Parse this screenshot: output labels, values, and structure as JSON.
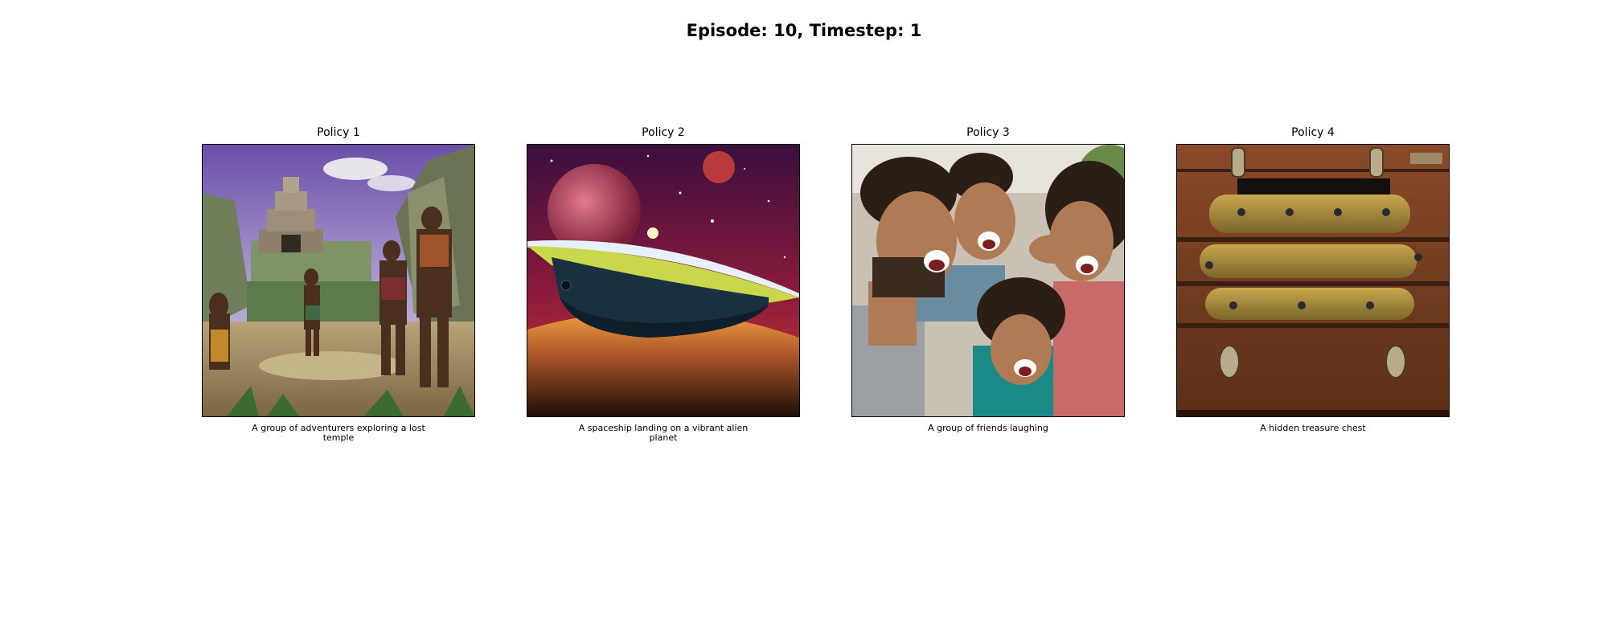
{
  "title": "Episode: 10, Timestep: 1",
  "panels": [
    {
      "label": "Policy 1",
      "caption": "A group of adventurers exploring a lost temple"
    },
    {
      "label": "Policy 2",
      "caption": "A spaceship landing on a vibrant alien planet"
    },
    {
      "label": "Policy 3",
      "caption": "A group of friends laughing"
    },
    {
      "label": "Policy 4",
      "caption": "A hidden treasure chest"
    }
  ]
}
